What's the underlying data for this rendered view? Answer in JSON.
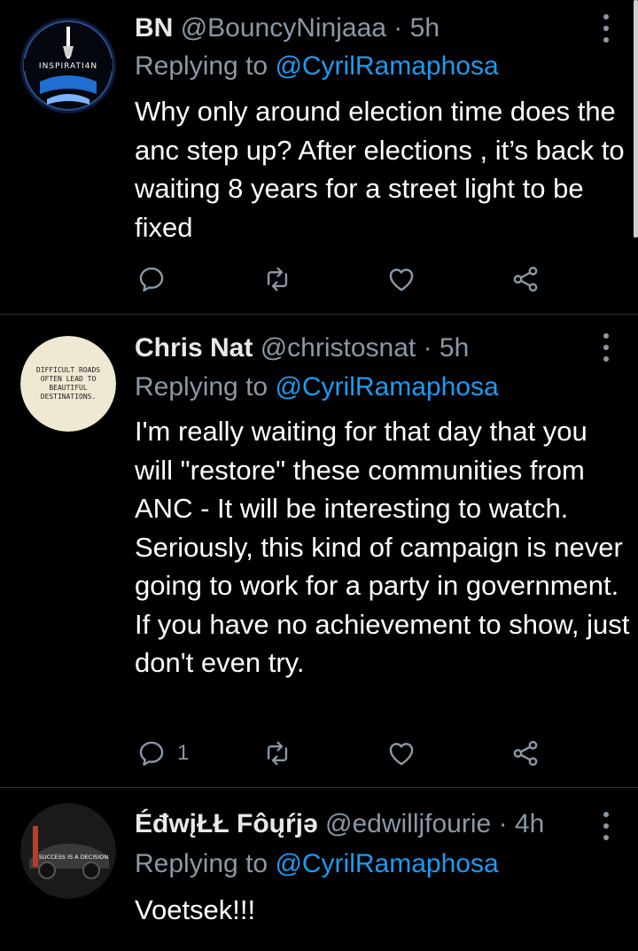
{
  "colors": {
    "background": "#000000",
    "text": "#ffffff",
    "secondary": "#8b98a5",
    "link": "#1d9bf0",
    "divider": "#2f3336"
  },
  "icons": {
    "reply": "reply-icon",
    "retweet": "retweet-icon",
    "like": "heart-icon",
    "share": "share-icon",
    "more": "more-vertical-icon"
  },
  "tweets": [
    {
      "name": "BN",
      "handle": "@BouncyNinjaaa",
      "dot": "·",
      "time": "5h",
      "replying_prefix": "Replying to",
      "replying_to": "@CyrilRamaphosa",
      "text": "Why only around election time does the anc step up? After elections , it’s back to waiting 8 years for a street light to be fixed",
      "avatar_text": "INSPIRATI4N",
      "reply_count": ""
    },
    {
      "name": "Chris Nat",
      "handle": "@christosnat",
      "dot": "·",
      "time": "5h",
      "replying_prefix": "Replying to",
      "replying_to": "@CyrilRamaphosa",
      "text": "I'm really waiting for that day that you will \"restore\" these communities from ANC - It will be interesting to watch. Seriously, this kind of campaign is never going to work for a party in government. If you have no achievement to show, just don't even try.",
      "avatar_text": "DIFFICULT ROADS OFTEN LEAD TO BEAUTIFUL DESTINATIONS.",
      "reply_count": "1"
    },
    {
      "name": "ÉđwįŁŁ Fôųŕjə",
      "handle": "@edwilljfourie",
      "dot": "·",
      "time": "4h",
      "replying_prefix": "Replying to",
      "replying_to": "@CyrilRamaphosa",
      "text": "Voetsek!!!",
      "avatar_text": "SUCCESS IS A DECISION",
      "reply_count": ""
    }
  ]
}
